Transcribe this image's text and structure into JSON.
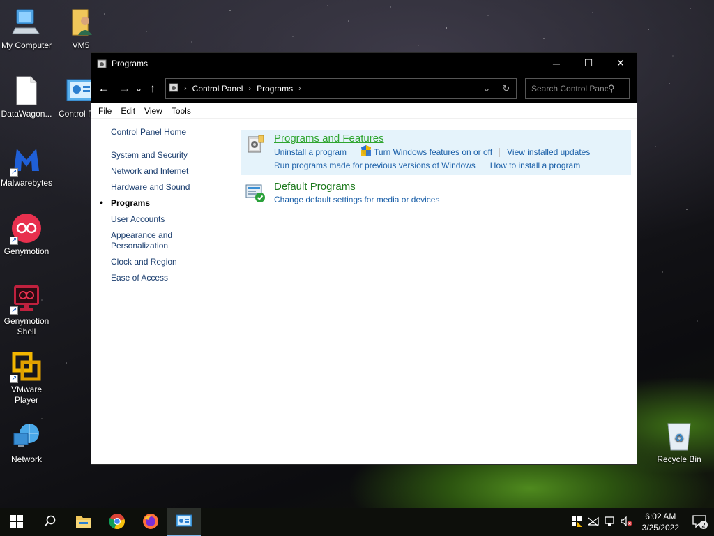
{
  "desktop": {
    "icons": [
      {
        "label": "My Computer",
        "icon": "computer-icon"
      },
      {
        "label": "VM5",
        "icon": "user-folder-icon"
      },
      {
        "label": "DataWagon...",
        "icon": "document-icon"
      },
      {
        "label": "Control P",
        "icon": "control-panel-icon"
      },
      {
        "label": "Malwarebytes",
        "icon": "malwarebytes-icon"
      },
      {
        "label": "Genymotion",
        "icon": "genymotion-icon"
      },
      {
        "label": "Genymotion Shell",
        "icon": "genymotion-shell-icon"
      },
      {
        "label": "VMware Player",
        "icon": "vmware-icon"
      },
      {
        "label": "Network",
        "icon": "network-icon"
      },
      {
        "label": "Recycle Bin",
        "icon": "recycle-bin-icon"
      }
    ]
  },
  "window": {
    "title": "Programs",
    "controls": {
      "minimize": "─",
      "maximize": "☐",
      "close": "✕"
    }
  },
  "navigation": {
    "back": "←",
    "forward": "→",
    "recent": "⌄",
    "up": "↑",
    "breadcrumb": [
      "Control Panel",
      "Programs"
    ],
    "dropdown": "⌄",
    "refresh": "↻",
    "search_placeholder": "Search Control Panel"
  },
  "menu": [
    "File",
    "Edit",
    "View",
    "Tools"
  ],
  "sidebar": {
    "home": "Control Panel Home",
    "items": [
      {
        "label": "System and Security",
        "active": false
      },
      {
        "label": "Network and Internet",
        "active": false
      },
      {
        "label": "Hardware and Sound",
        "active": false
      },
      {
        "label": "Programs",
        "active": true
      },
      {
        "label": "User Accounts",
        "active": false
      },
      {
        "label": "Appearance and Personalization",
        "active": false
      },
      {
        "label": "Clock and Region",
        "active": false
      },
      {
        "label": "Ease of Access",
        "active": false
      }
    ]
  },
  "categories": [
    {
      "title": "Programs and Features",
      "icon": "programs-features-icon",
      "links_row1": [
        "Uninstall a program",
        "Turn Windows features on or off",
        "View installed updates"
      ],
      "links_row2": [
        "Run programs made for previous versions of Windows",
        "How to install a program"
      ]
    },
    {
      "title": "Default Programs",
      "icon": "default-programs-icon",
      "links_row1": [
        "Change default settings for media or devices"
      ]
    }
  ],
  "taskbar": {
    "apps": [
      "start-icon",
      "search-icon",
      "file-explorer-icon",
      "chrome-icon",
      "firefox-icon",
      "control-panel-icon"
    ],
    "clock_time": "6:02 AM",
    "clock_date": "3/25/2022",
    "notification_count": "2"
  },
  "colors": {
    "link": "#1a5fa8",
    "category_title": "#1e7a1e",
    "highlight_bg": "#e5f3fb",
    "titlebar": "#000000"
  }
}
